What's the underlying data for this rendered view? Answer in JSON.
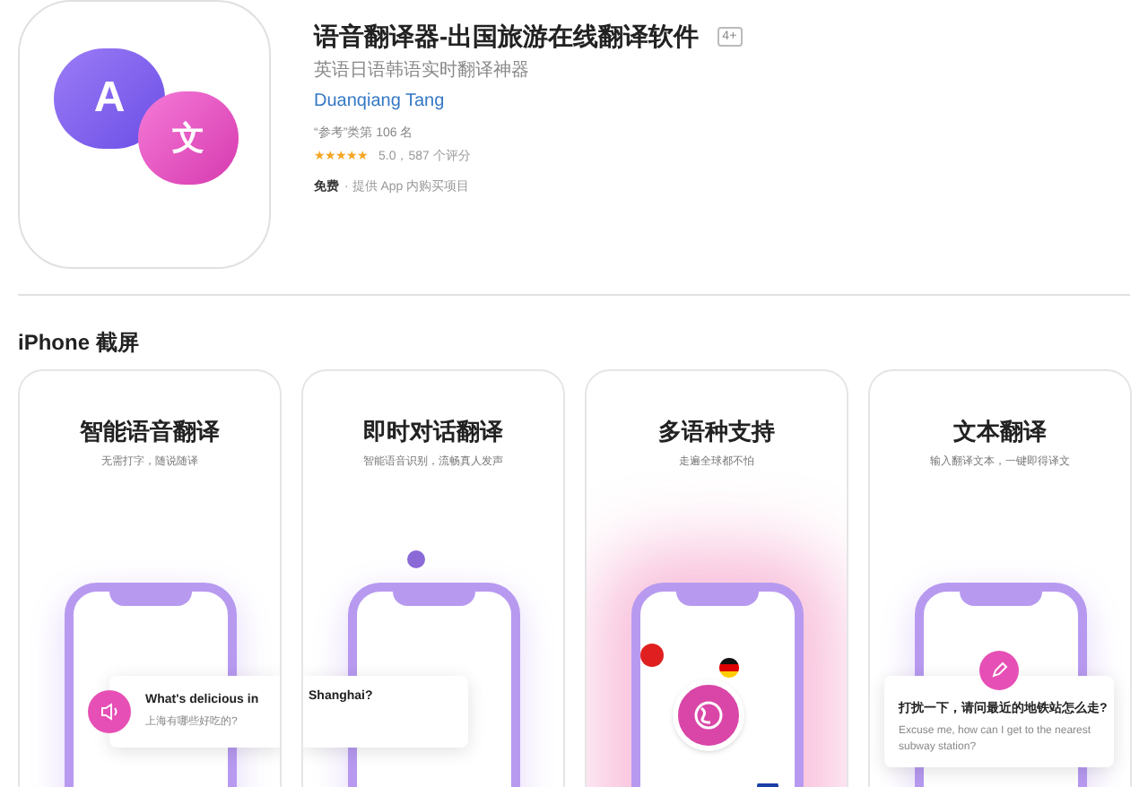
{
  "app": {
    "title": "语音翻译器-出国旅游在线翻译软件",
    "age_badge": "4+",
    "subtitle": "英语日语韩语实时翻译神器",
    "developer": "Duanqiang Tang",
    "rank": "“参考”类第 106 名",
    "stars": 5,
    "rating_text": "5.0，587 个评分",
    "price": "免费",
    "price_note": "· 提供 App 内购买项目",
    "icon_letter": "A",
    "icon_glyph": "文"
  },
  "section_title": "iPhone 截屏",
  "screenshots": [
    {
      "kind": "voice",
      "heading": "智能语音翻译",
      "caption": "无需打字，随说随译",
      "bubble_title": "What's delicious in",
      "bubble_text": "上海有哪些好吃的?"
    },
    {
      "kind": "dialog",
      "heading": "即时对话翻译",
      "caption": "智能语音识别，流畅真人发声",
      "bubble_title": "Shanghai?"
    },
    {
      "kind": "languages",
      "heading": "多语种支持",
      "caption": "走遍全球都不怕"
    },
    {
      "kind": "text",
      "heading": "文本翻译",
      "caption": "输入翻译文本，一键即得译文",
      "bubble_title": "打扰一下，请问最近的地铁站怎么走?",
      "bubble_text": "Excuse me, how can I get to the nearest subway station?"
    }
  ]
}
